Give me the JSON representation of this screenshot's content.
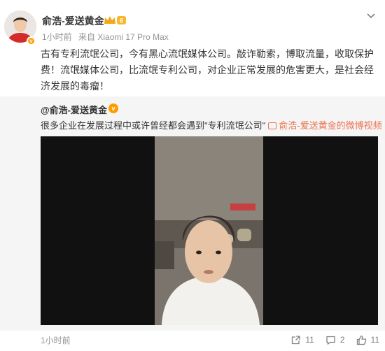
{
  "post": {
    "author": "俞浩-爱送黄金",
    "time": "1小时前",
    "source": "来自 Xiaomi 17 Pro Max",
    "content": "古有专利流氓公司，今有黑心流氓媒体公司。敲诈勒索，博取流量，收取保护费！流氓媒体公司，比流氓专利公司，对企业正常发展的危害更大，是社会经济发展的毒瘤！"
  },
  "repost": {
    "author": "@俞浩-爱送黄金",
    "text": "很多企业在发展过程中或许曾经都会遇到\"专利流氓公司\"",
    "link_text": "俞浩-爱送黄金的微博视频"
  },
  "footer": {
    "time": "1小时前",
    "repost_count": "11",
    "comment_count": "2",
    "like_count": "11"
  },
  "colors": {
    "link": "#eb7350",
    "badge": "#ff9d00",
    "meta": "#939393",
    "repost_bg": "#f5f5f5"
  },
  "icons": [
    "verified-badge",
    "crown-badge",
    "chevron-down-icon",
    "video-link-icon",
    "repost-icon",
    "comment-icon",
    "like-icon"
  ]
}
